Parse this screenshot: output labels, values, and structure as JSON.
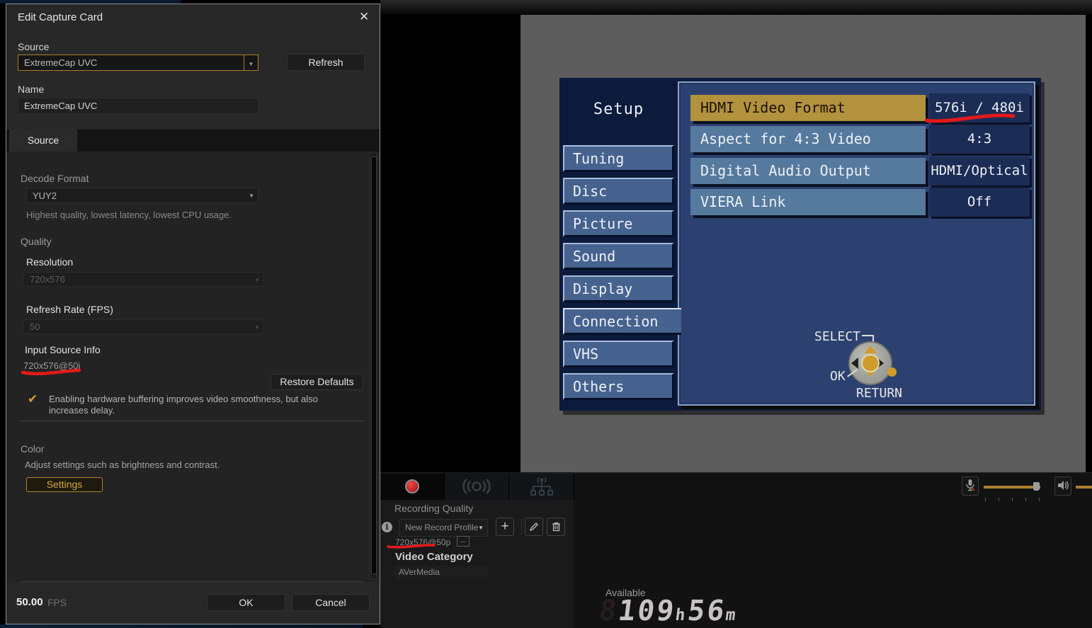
{
  "colors": {
    "accent_gold": "#b98a2e",
    "tv_highlight_gold": "#b3923d",
    "annotation_red": "#e11a1a",
    "record_red": "#c11717",
    "video_background_gray": "#5d5d5d"
  },
  "icons": {
    "close": "✕",
    "caret": "▼",
    "check": "✔",
    "plus": "+",
    "info": "i"
  },
  "dialog": {
    "title": "Edit Capture Card",
    "source_label": "Source",
    "source_value": "ExtremeCap UVC",
    "refresh_button": "Refresh",
    "name_label": "Name",
    "name_value": "ExtremeCap UVC",
    "tab_source": "Source",
    "decode_format_label": "Decode Format",
    "decode_format_value": "YUY2",
    "decode_format_hint": "Highest quality, lowest latency, lowest CPU usage.",
    "quality_label": "Quality",
    "resolution_label": "Resolution",
    "resolution_value": "720x576",
    "refresh_rate_label": "Refresh Rate (FPS)",
    "refresh_rate_value": "50",
    "input_source_info_label": "Input Source Info",
    "input_source_info_value": "720x576@50i",
    "restore_defaults_button": "Restore Defaults",
    "buffering_note_line1": "Enabling hardware buffering improves video smoothness, but also",
    "buffering_note_line2": "increases delay.",
    "color_label": "Color",
    "color_hint": "Adjust settings such as brightness and contrast.",
    "settings_button": "Settings",
    "fps_value": "50.00",
    "fps_unit": "FPS",
    "ok_button": "OK",
    "cancel_button": "Cancel"
  },
  "tv_menu": {
    "header": "Setup",
    "sidebar": [
      "Tuning",
      "Disc",
      "Picture",
      "Sound",
      "Display",
      "Connection",
      "VHS",
      "Others"
    ],
    "selected_sidebar": "Connection",
    "rows": [
      {
        "label": "HDMI Video Format",
        "value": "576i / 480i",
        "selected": true
      },
      {
        "label": "Aspect for 4:3 Video",
        "value": "4:3",
        "selected": false
      },
      {
        "label": "Digital Audio Output",
        "value": "HDMI/Optical",
        "selected": false
      },
      {
        "label": "VIERA Link",
        "value": "Off",
        "selected": false
      }
    ],
    "select_label": "SELECT",
    "ok_label": "OK",
    "return_label": "RETURN"
  },
  "bottom_bar": {
    "recording_quality_label": "Recording Quality",
    "profile_value": "New Record Profile",
    "profile_detail": "720x576@50p",
    "more_button": "...",
    "video_category_label": "Video Category",
    "video_category_value": "AVerMedia",
    "available_label": "Available",
    "available_time": {
      "ghost": "8",
      "hours": "109",
      "hour_unit": "h",
      "minutes": "56",
      "minute_unit": "m"
    }
  }
}
